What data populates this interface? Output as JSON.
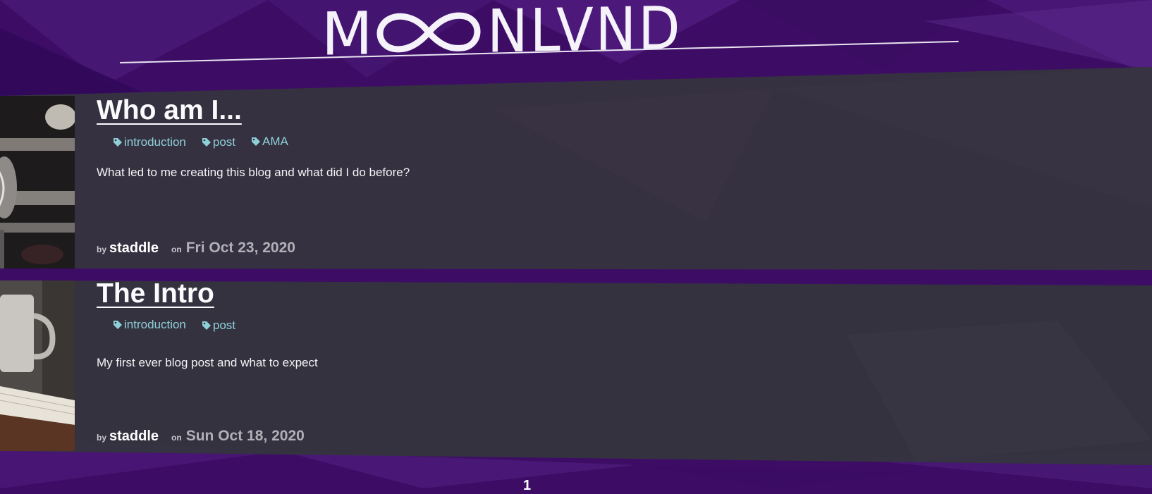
{
  "site": {
    "logo_text": "NLVND",
    "logo_letter_m": "M"
  },
  "posts": [
    {
      "title": "Who am I...",
      "tags": [
        "introduction",
        "post",
        "AMA"
      ],
      "excerpt": "What led to me creating this blog and what did I do before?",
      "by_label": "by",
      "author": "staddle",
      "on_label": "on",
      "date": "Fri Oct 23, 2020",
      "thumbnail": "microphone-photo"
    },
    {
      "title": "The Intro",
      "tags": [
        "introduction",
        "post"
      ],
      "excerpt": "My first ever blog post and what to expect",
      "by_label": "by",
      "author": "staddle",
      "on_label": "on",
      "date": "Sun Oct 18, 2020",
      "thumbnail": "coffee-mug-and-book-photo"
    }
  ],
  "pagination": {
    "current_page": "1"
  },
  "colors": {
    "background": "#3d0d66",
    "card": "#35333f",
    "tag": "#8fd0d8",
    "title": "#fbfbfd"
  },
  "icons": {
    "tag": "tag-icon"
  }
}
